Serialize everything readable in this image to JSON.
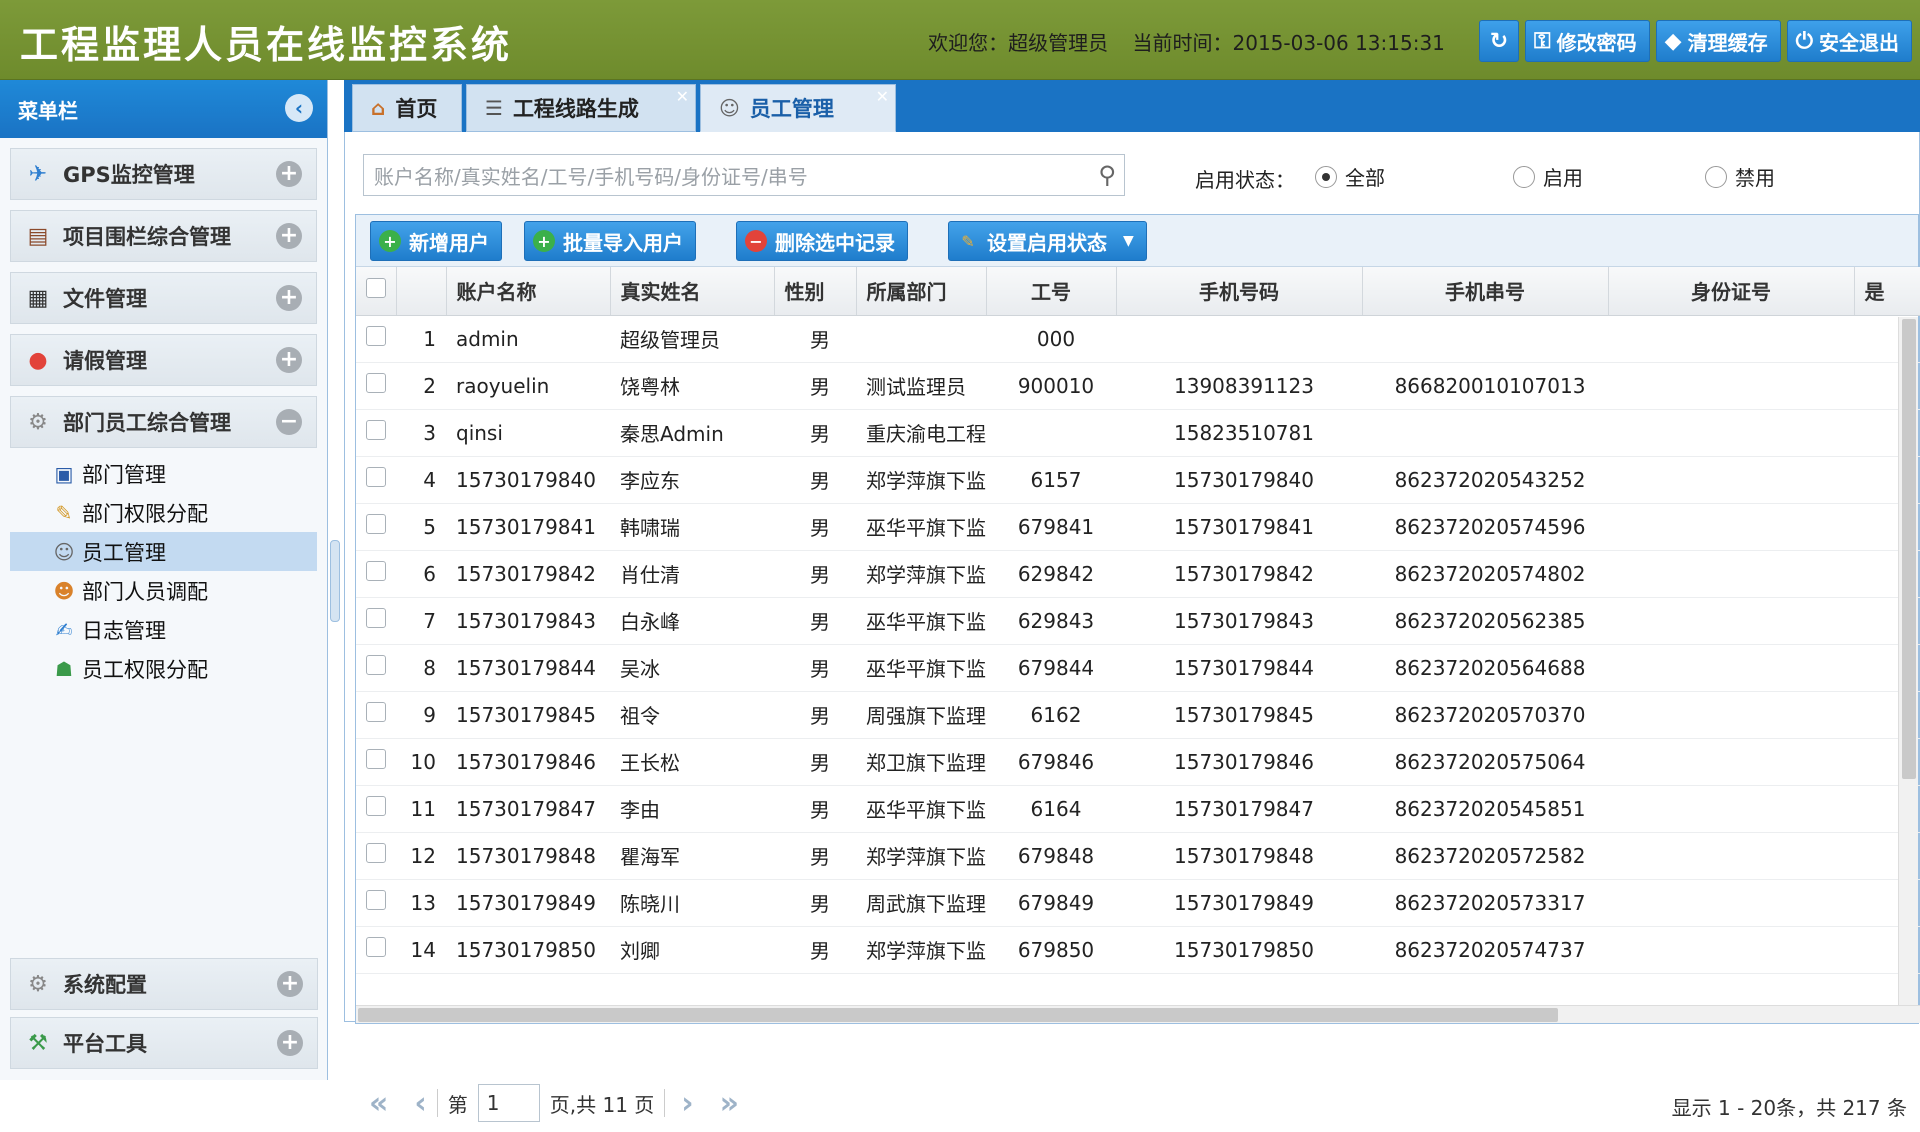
{
  "header": {
    "title": "工程监理人员在线监控系统",
    "welcome": "欢迎您：超级管理员",
    "time": "当前时间：2015-03-06 13:15:31",
    "buttons": {
      "change_password": "修改密码",
      "clear_cache": "清理缓存",
      "logout": "安全退出"
    }
  },
  "sidebar": {
    "title": "菜单栏",
    "sections": [
      {
        "label": "GPS监控管理",
        "icon": "satellite-icon"
      },
      {
        "label": "项目围栏综合管理",
        "icon": "ledger-icon"
      },
      {
        "label": "文件管理",
        "icon": "clipboard-icon"
      },
      {
        "label": "请假管理",
        "icon": "alert-icon"
      },
      {
        "label": "部门员工综合管理",
        "icon": "gear-icon"
      }
    ],
    "sub_items": [
      {
        "label": "部门管理"
      },
      {
        "label": "部门权限分配"
      },
      {
        "label": "员工管理"
      },
      {
        "label": "部门人员调配"
      },
      {
        "label": "日志管理"
      },
      {
        "label": "员工权限分配"
      }
    ],
    "bottom_sections": [
      {
        "label": "系统配置"
      },
      {
        "label": "平台工具"
      }
    ]
  },
  "tabs": [
    {
      "label": "首页"
    },
    {
      "label": "工程线路生成"
    },
    {
      "label": "员工管理"
    }
  ],
  "search": {
    "placeholder": "账户名称/真实姓名/工号/手机号码/身份证号/串号",
    "status_label": "启用状态：",
    "options": [
      "全部",
      "启用",
      "禁用"
    ],
    "selected": "全部"
  },
  "toolbar": {
    "add_user": "新增用户",
    "batch_import": "批量导入用户",
    "delete_selected": "删除选中记录",
    "set_status": "设置启用状态"
  },
  "table": {
    "columns": [
      "账户名称",
      "真实姓名",
      "性别",
      "所属部门",
      "工号",
      "手机号码",
      "手机串号",
      "身份证号",
      "是"
    ],
    "rows": [
      {
        "n": "1",
        "account": "admin",
        "name": "超级管理员",
        "sex": "男",
        "dept": "",
        "no": "000",
        "phone": "",
        "imei": "",
        "idcard": ""
      },
      {
        "n": "2",
        "account": "raoyuelin",
        "name": "饶粤林",
        "sex": "男",
        "dept": "测试监理员",
        "no": "900010",
        "phone": "13908391123",
        "imei": "866820010107013",
        "idcard": ""
      },
      {
        "n": "3",
        "account": "qinsi",
        "name": "秦思Admin",
        "sex": "男",
        "dept": "重庆渝电工程",
        "no": "",
        "phone": "15823510781",
        "imei": "",
        "idcard": ""
      },
      {
        "n": "4",
        "account": "15730179840",
        "name": "李应东",
        "sex": "男",
        "dept": "郑学萍旗下监",
        "no": "6157",
        "phone": "15730179840",
        "imei": "862372020543252",
        "idcard": ""
      },
      {
        "n": "5",
        "account": "15730179841",
        "name": "韩啸瑞",
        "sex": "男",
        "dept": "巫华平旗下监",
        "no": "679841",
        "phone": "15730179841",
        "imei": "862372020574596",
        "idcard": ""
      },
      {
        "n": "6",
        "account": "15730179842",
        "name": "肖仕清",
        "sex": "男",
        "dept": "郑学萍旗下监",
        "no": "629842",
        "phone": "15730179842",
        "imei": "862372020574802",
        "idcard": ""
      },
      {
        "n": "7",
        "account": "15730179843",
        "name": "白永峰",
        "sex": "男",
        "dept": "巫华平旗下监",
        "no": "629843",
        "phone": "15730179843",
        "imei": "862372020562385",
        "idcard": ""
      },
      {
        "n": "8",
        "account": "15730179844",
        "name": "吴冰",
        "sex": "男",
        "dept": "巫华平旗下监",
        "no": "679844",
        "phone": "15730179844",
        "imei": "862372020564688",
        "idcard": ""
      },
      {
        "n": "9",
        "account": "15730179845",
        "name": "祖令",
        "sex": "男",
        "dept": "周强旗下监理",
        "no": "6162",
        "phone": "15730179845",
        "imei": "862372020570370",
        "idcard": ""
      },
      {
        "n": "10",
        "account": "15730179846",
        "name": "王长松",
        "sex": "男",
        "dept": "郑卫旗下监理",
        "no": "679846",
        "phone": "15730179846",
        "imei": "862372020575064",
        "idcard": ""
      },
      {
        "n": "11",
        "account": "15730179847",
        "name": "李由",
        "sex": "男",
        "dept": "巫华平旗下监",
        "no": "6164",
        "phone": "15730179847",
        "imei": "862372020545851",
        "idcard": ""
      },
      {
        "n": "12",
        "account": "15730179848",
        "name": "瞿海军",
        "sex": "男",
        "dept": "郑学萍旗下监",
        "no": "679848",
        "phone": "15730179848",
        "imei": "862372020572582",
        "idcard": ""
      },
      {
        "n": "13",
        "account": "15730179849",
        "name": "陈晓川",
        "sex": "男",
        "dept": "周武旗下监理",
        "no": "679849",
        "phone": "15730179849",
        "imei": "862372020573317",
        "idcard": ""
      },
      {
        "n": "14",
        "account": "15730179850",
        "name": "刘卿",
        "sex": "男",
        "dept": "郑学萍旗下监",
        "no": "679850",
        "phone": "15730179850",
        "imei": "862372020574737",
        "idcard": ""
      }
    ]
  },
  "pager": {
    "page_prefix": "第",
    "page_value": "1",
    "page_suffix": "页,共 11 页",
    "info": "显示 1 - 20条，共 217 条"
  },
  "colors": {
    "header_green": "#7d9a39",
    "accent_blue": "#1a73c4",
    "button_blue": "#1f7dcc"
  }
}
